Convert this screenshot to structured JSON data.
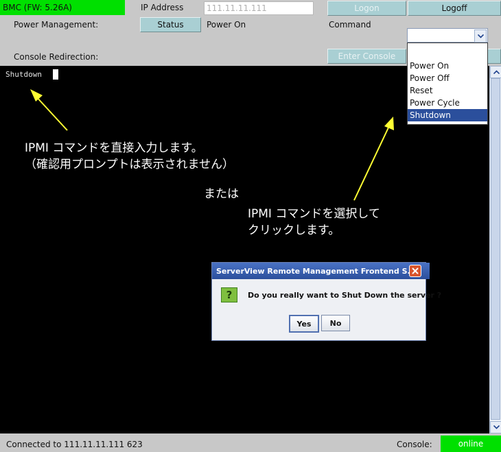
{
  "header": {
    "bmc_label": "BMC (FW: 5.26A)",
    "ip_label": "IP Address",
    "ip_value": "111.11.11.111",
    "logon_label": "Logon",
    "logoff_label": "Logoff"
  },
  "power": {
    "label": "Power Management:",
    "status_button": "Status",
    "status_value": "Power On",
    "command_label": "Command"
  },
  "console_row": {
    "label": "Console Redirection:",
    "enter_console_button": "Enter Console"
  },
  "command_dropdown": {
    "selected": "",
    "options": [
      "Power On",
      "Power Off",
      "Reset",
      "Power Cycle",
      "Shutdown"
    ],
    "highlighted": "Shutdown"
  },
  "console": {
    "typed_text": "Shutdown"
  },
  "annotations": {
    "left_line1": "IPMI コマンドを直接入力します。",
    "left_line2": "（確認用プロンプトは表示されません）",
    "or": "または",
    "right_line1": "IPMI コマンドを選択して",
    "right_line2": "クリックします。"
  },
  "dialog": {
    "title": "ServerView Remote Management Frontend S...",
    "message": "Do you really want to Shut Down the server ?",
    "yes": "Yes",
    "no": "No"
  },
  "status_bar": {
    "connection": "Connected to 111.11.11.111 623",
    "console_label": "Console:",
    "console_state": "online"
  },
  "colors": {
    "online_green": "#00e000",
    "button_teal": "#a9cfd3",
    "highlight_blue": "#2b4f9c",
    "annotation_yellow": "#ffff33"
  }
}
